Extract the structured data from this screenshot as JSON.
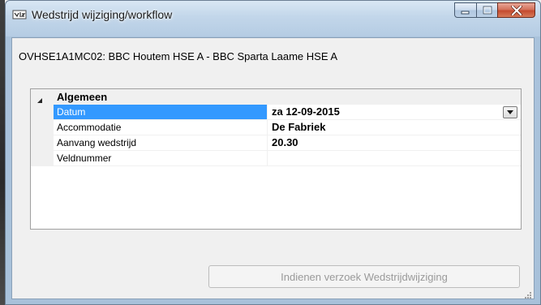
{
  "window": {
    "title": "Wedstrijd wijziging/workflow",
    "icon": "app-icon"
  },
  "match": {
    "label": "OVHSE1A1MC02: BBC Houtem HSE A - BBC Sparta Laame HSE A"
  },
  "grid": {
    "category": "Algemeen",
    "rows": [
      {
        "name": "Datum",
        "value": "za 12-09-2015",
        "selected": true
      },
      {
        "name": "Accommodatie",
        "value": "De Fabriek",
        "selected": false
      },
      {
        "name": "Aanvang wedstrijd",
        "value": "20.30",
        "selected": false
      },
      {
        "name": "Veldnummer",
        "value": "",
        "selected": false
      }
    ]
  },
  "actions": {
    "submit_label": "Indienen verzoek Wedstrijdwijziging"
  },
  "colors": {
    "selection": "#3399ff",
    "titlebar": "#c2d6ea",
    "close": "#c44a2f"
  }
}
